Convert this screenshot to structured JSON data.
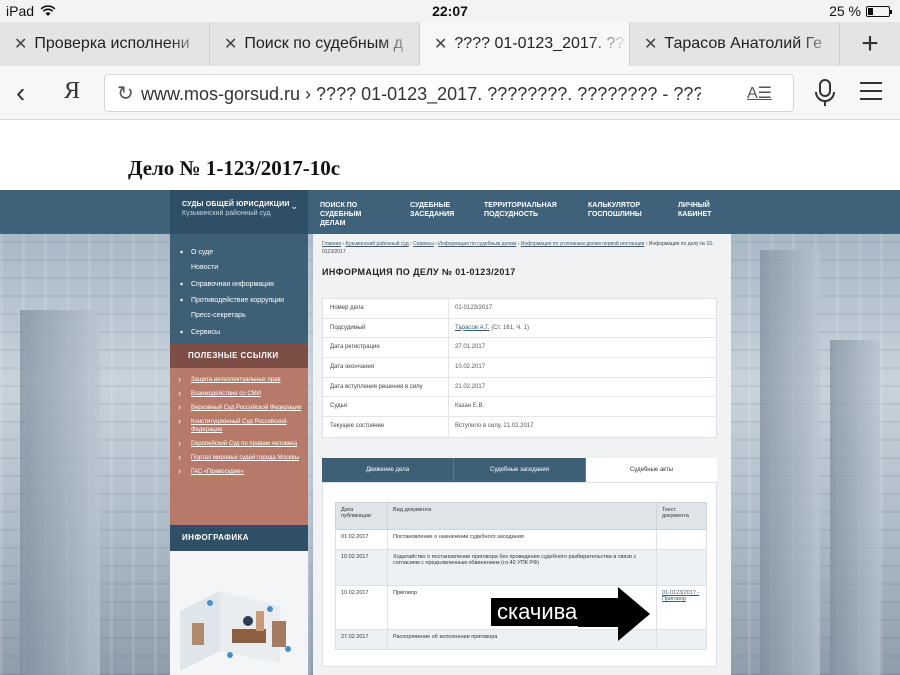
{
  "status": {
    "device": "iPad",
    "time": "22:07",
    "battery": "25 %",
    "battery_level": 0.25
  },
  "tabs": [
    {
      "label": "Проверка исполнени",
      "active": false
    },
    {
      "label": "Поиск по судебным д",
      "active": false
    },
    {
      "label": "???? 01-0123_2017. ??",
      "active": true
    },
    {
      "label": "Тарасов Анатолий Ге",
      "active": false
    }
  ],
  "browser": {
    "back": "‹",
    "yandex": "Я",
    "url": "www.mos-gorsud.ru › ???? 01-0123_2017. ????????. ???????? - ??????",
    "reader": "A☰",
    "new_tab": "+"
  },
  "page": {
    "heading": "Дело № 1-123/2017-10с",
    "court_select": {
      "title": "СУДЫ ОБЩЕЙ ЮРИСДИКЦИИ",
      "subtitle": "Кузьминский районный суд"
    },
    "nav": [
      "Поиск по судебным делам",
      "Судебные заседания",
      "Территориальная подсудность",
      "Калькулятор госпошлины",
      "Личный кабинет"
    ],
    "side_menu": [
      {
        "label": "О суде",
        "arrow": true
      },
      {
        "label": "Новости",
        "arrow": false
      },
      {
        "label": "Справочная информация",
        "arrow": true
      },
      {
        "label": "Противодействие коррупции",
        "arrow": true
      },
      {
        "label": "Пресс-секретарь",
        "arrow": false
      },
      {
        "label": "Сервисы",
        "arrow": true
      }
    ],
    "useful_links_title": "ПОЛЕЗНЫЕ ССЫЛКИ",
    "useful_links": [
      "Защита интеллектуальных прав",
      "Взаимодействие со СМИ",
      "Верховный Суд Российской Федерации",
      "Конституционный Суд Российской Федерации",
      "Европейский Суд по правам человека",
      "Портал мировых судей города Москвы",
      "ГАС «Правосудие»"
    ],
    "infographics_title": "ИНФОГРАФИКА",
    "breadcrumbs": [
      "Главная",
      "Кузьминский районный суд",
      "Сервисы",
      "Информация по судебным делам",
      "Информация по уголовным делам первой инстанции",
      "Информация по делу № 01-0123/2017"
    ],
    "title": "ИНФОРМАЦИЯ ПО ДЕЛУ № 01-0123/2017",
    "info": [
      {
        "label": "Номер дела",
        "value": "01-0123/2017",
        "link": false
      },
      {
        "label": "Подсудимый",
        "value": "Тарасов А.Г.",
        "extra": " (Ст. 161, Ч. 1)",
        "link": true
      },
      {
        "label": "Дата регистрации",
        "value": "27.01.2017",
        "link": false
      },
      {
        "label": "Дата окончания",
        "value": "10.02.2017",
        "link": false
      },
      {
        "label": "Дата вступления решения в силу",
        "value": "21.02.2017",
        "link": false
      },
      {
        "label": "Судья",
        "value": "Казан Е.В.",
        "link": false
      },
      {
        "label": "Текущее состояние",
        "value": "Вступило в силу, 21.02.2017",
        "link": false
      }
    ],
    "doc_tabs": [
      "Движение дела",
      "Судебные заседания",
      "Судебные акты"
    ],
    "doc_headers": [
      "Дата публикации",
      "Вид документа",
      "Текст документа"
    ],
    "docs": [
      {
        "date": "01.02.2017",
        "type": "Постановление о назначении судебного заседания",
        "text": ""
      },
      {
        "date": "10.02.2017",
        "type": "Ходатайство о постановлении приговора без проведения судебного разбирательства в связи с согласием с предъявленным обвинением (гл.40 УПК РФ)",
        "text": ""
      },
      {
        "date": "10.02.2017",
        "type": "Приговор",
        "text": "01-0123/2017 - Приговор"
      },
      {
        "date": "27.02.2017",
        "type": "Распоряжение об исполнении приговора",
        "text": ""
      }
    ]
  },
  "callout": {
    "text": "скачивание"
  }
}
